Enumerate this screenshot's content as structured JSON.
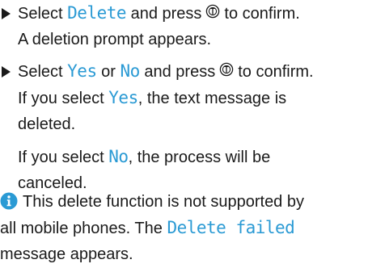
{
  "step1": {
    "pre": "Select",
    "keyword": "Delete",
    "mid": "and press",
    "post": "to confirm.",
    "result": "A deletion prompt appears."
  },
  "step2": {
    "pre": "Select",
    "keyword_yes": "Yes",
    "or": "or",
    "keyword_no": "No",
    "mid": "and press",
    "post": "to confirm.",
    "yes_pre": "If you select",
    "yes_keyword": "Yes",
    "yes_post": ", the text message is",
    "yes_post2": "deleted.",
    "no_pre": "If you select",
    "no_keyword": "No",
    "no_post": ", the process will be",
    "no_post2": "canceled."
  },
  "note": {
    "line1": "This delete function is not supported by",
    "line2_pre": "all mobile phones. The",
    "keyword": "Delete failed",
    "line3": "message appears."
  },
  "colors": {
    "keyword": "#2a9ad4",
    "info_icon": "#2a9ad4",
    "text": "#1a1a1a"
  },
  "icons": {
    "confirm": "ok-button-icon",
    "info": "info-icon",
    "bullet": "triangle-bullet-icon"
  }
}
